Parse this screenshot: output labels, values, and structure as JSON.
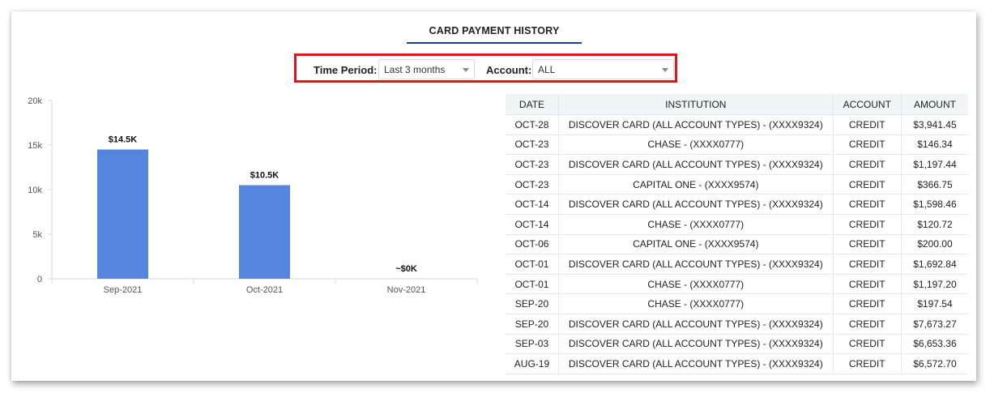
{
  "tab": {
    "title": "CARD PAYMENT HISTORY"
  },
  "filters": {
    "time_period_label": "Time Period:",
    "time_period_value": "Last 3 months",
    "account_label": "Account:",
    "account_value": "ALL"
  },
  "chart_data": {
    "type": "bar",
    "categories": [
      "Sep-2021",
      "Oct-2021",
      "Nov-2021"
    ],
    "values": [
      14500,
      10500,
      0
    ],
    "data_labels": [
      "$14.5K",
      "$10.5K",
      "~$0K"
    ],
    "ylim": [
      0,
      20000
    ],
    "yticks": [
      0,
      5000,
      10000,
      15000,
      20000
    ],
    "ytick_labels": [
      "0",
      "5k",
      "10k",
      "15k",
      "20k"
    ],
    "bar_color": "#5585dc",
    "grid": false
  },
  "table": {
    "headers": [
      "DATE",
      "INSTITUTION",
      "ACCOUNT",
      "AMOUNT"
    ],
    "rows": [
      [
        "OCT-28",
        "DISCOVER CARD (ALL ACCOUNT TYPES) - (XXXX9324)",
        "CREDIT",
        "$3,941.45"
      ],
      [
        "OCT-23",
        "CHASE - (XXXX0777)",
        "CREDIT",
        "$146.34"
      ],
      [
        "OCT-23",
        "DISCOVER CARD (ALL ACCOUNT TYPES) - (XXXX9324)",
        "CREDIT",
        "$1,197.44"
      ],
      [
        "OCT-23",
        "CAPITAL ONE - (XXXX9574)",
        "CREDIT",
        "$366.75"
      ],
      [
        "OCT-14",
        "DISCOVER CARD (ALL ACCOUNT TYPES) - (XXXX9324)",
        "CREDIT",
        "$1,598.46"
      ],
      [
        "OCT-14",
        "CHASE - (XXXX0777)",
        "CREDIT",
        "$120.72"
      ],
      [
        "OCT-06",
        "CAPITAL ONE - (XXXX9574)",
        "CREDIT",
        "$200.00"
      ],
      [
        "OCT-01",
        "DISCOVER CARD (ALL ACCOUNT TYPES) - (XXXX9324)",
        "CREDIT",
        "$1,692.84"
      ],
      [
        "OCT-01",
        "CHASE - (XXXX0777)",
        "CREDIT",
        "$1,197.20"
      ],
      [
        "SEP-20",
        "CHASE - (XXXX0777)",
        "CREDIT",
        "$197.54"
      ],
      [
        "SEP-20",
        "DISCOVER CARD (ALL ACCOUNT TYPES) - (XXXX9324)",
        "CREDIT",
        "$7,673.27"
      ],
      [
        "SEP-03",
        "DISCOVER CARD (ALL ACCOUNT TYPES) - (XXXX9324)",
        "CREDIT",
        "$6,653.36"
      ],
      [
        "AUG-19",
        "DISCOVER CARD (ALL ACCOUNT TYPES) - (XXXX9324)",
        "CREDIT",
        "$6,572.70"
      ]
    ]
  },
  "colors": {
    "accent": "#1f3f7f",
    "highlight_border": "#e0141b",
    "header_bg": "#f2f4f7"
  }
}
